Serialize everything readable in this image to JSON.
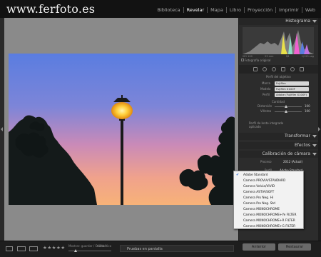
{
  "brand": "www.ferfoto.es",
  "modules": [
    "Biblioteca",
    "Revelar",
    "Mapa",
    "Libro",
    "Proyección",
    "Imprimir",
    "Web"
  ],
  "active_module": "Revelar",
  "panel": {
    "histogram_title": "Histograma",
    "histogram_labels": [
      "ISO 100",
      "23 mm",
      "f/8",
      "1/125 seg"
    ],
    "original_photo": "Fotografía original",
    "camera_header": "Perfil del objetivo",
    "marca_label": "Marca",
    "marca_value": "Fujifilm",
    "modelo_label": "Modelo",
    "modelo_value": "Fujifilm X100F",
    "perfil_label": "Perfil",
    "perfil_value": "Adobe (Fujifilm X100F)",
    "cantidad_header": "Cantidad",
    "distorsion_label": "Distorsión",
    "distorsion_value": "100",
    "vineteo_label": "Viñeteo",
    "vineteo_value": "100",
    "profile_note_1": "Perfil de lente integrado",
    "profile_note_2": "aplicado",
    "transform_title": "Transformar",
    "effects_title": "Efectos",
    "calibration_title": "Calibración de cámara",
    "process_label": "Proceso",
    "process_value": "2012 (Actual)",
    "perfil2_label": "Perfil",
    "perfil2_value": "Adobe Standard"
  },
  "dropdown": {
    "items": [
      "Adobe Standard",
      "Camera PROVIA/STANDARD",
      "Camera Velvia/VIVID",
      "Camera ASTIA/SOFT",
      "Camera Pro Neg. Hi",
      "Camera Pro Neg. Std",
      "Camera MONOCHROME",
      "Camera MONOCHROME+Ye FILTER",
      "Camera MONOCHROME+R FILTER",
      "Camera MONOCHROME+G FILTER"
    ],
    "selected_index": 0
  },
  "bottom": {
    "stars": "★★★★★",
    "sort_label": "Mostrar: guardar / Ocultar",
    "sort_value": "Alfabético",
    "preview_select": "Pruebas en pantalla",
    "previous_button": "Anterior",
    "reset_button": "Restaurar"
  },
  "colors": {
    "accent_check": "#1e62d0",
    "dropdown_bg": "#f2f2f2",
    "canvas_bg": "#8a8a8a"
  }
}
